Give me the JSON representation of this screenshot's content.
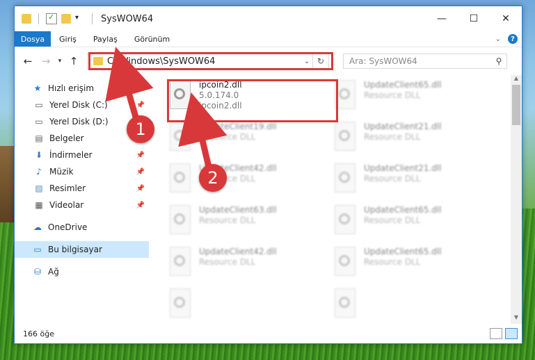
{
  "window": {
    "title": "SysWOW64"
  },
  "ribbon": {
    "tabs": [
      "Dosya",
      "Giriş",
      "Paylaş",
      "Görünüm"
    ]
  },
  "address": {
    "path": "C:\\Windows\\SysWOW64"
  },
  "search": {
    "placeholder": "Ara: SysWOW64"
  },
  "nav": {
    "quick_access": "Hızlı erişim",
    "items": [
      "Yerel Disk (C:)",
      "Yerel Disk (D:)",
      "Belgeler",
      "İndirmeler",
      "Müzik",
      "Resimler",
      "Videolar"
    ],
    "onedrive": "OneDrive",
    "this_pc": "Bu bilgisayar",
    "network": "Ağ"
  },
  "files": [
    {
      "name": "ipcoin2.dll",
      "line2": "5.0.174.0",
      "line3": "ipcoin2.dll"
    },
    {
      "name": "UpdateClient65.dll",
      "line2": "Resource DLL"
    },
    {
      "name": "UpdateClient19.dll",
      "line2": "Resource DLL"
    },
    {
      "name": "UpdateClient21.dll",
      "line2": "Resource DLL"
    },
    {
      "name": "UpdateClient42.dll",
      "line2": "Resource DLL"
    },
    {
      "name": "UpdateClient21.dll",
      "line2": "Resource DLL"
    },
    {
      "name": "UpdateClient63.dll",
      "line2": "Resource DLL"
    },
    {
      "name": "UpdateClient65.dll",
      "line2": "Resource DLL"
    },
    {
      "name": "UpdateClient42.dll",
      "line2": "Resource DLL"
    },
    {
      "name": "UpdateClient65.dll",
      "line2": "Resource DLL"
    },
    {
      "name": "",
      "line2": ""
    },
    {
      "name": "",
      "line2": ""
    }
  ],
  "status": {
    "count": "166 öğe"
  },
  "annotations": {
    "step1": "1",
    "step2": "2",
    "color": "#d9383a"
  }
}
